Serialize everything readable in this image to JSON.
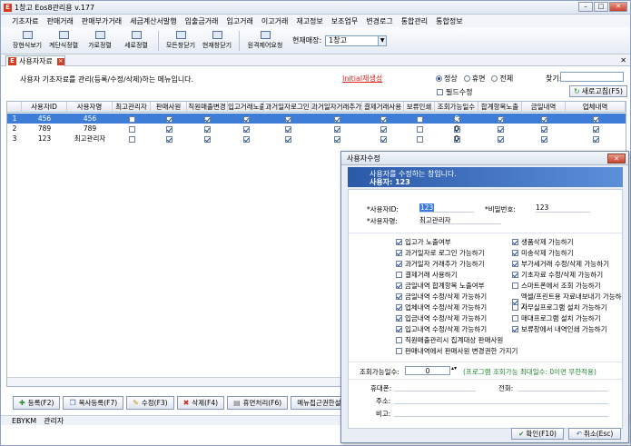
{
  "window": {
    "title": "1창고 Eos8관리용 v.177"
  },
  "menu": [
    "기초자료",
    "판매거래",
    "판매부가거래",
    "세금계산서발행",
    "입출금거래",
    "입고거래",
    "이고거래",
    "재고정보",
    "보조업무",
    "변경로그",
    "통합관리",
    "통합정보"
  ],
  "toolbar": {
    "buttons": [
      "장현식보기",
      "계단식정렬",
      "가로정렬",
      "세로정렬",
      "모든창닫기",
      "현재창닫기",
      "원격제어요청"
    ],
    "store_label": "현재매장:",
    "store_value": "1창고"
  },
  "tab": {
    "label": "사용자자료"
  },
  "info": {
    "description": "사용자 기초자료를 관리(등록/수정/삭제)하는 메뉴입니다.",
    "link": "Initial재생성",
    "radio_normal": "정상",
    "radio_leave": "휴면",
    "radio_all": "전체",
    "find_label": "찾기:",
    "filter_label": "필드수정",
    "refresh_label": "새로고침(F5)"
  },
  "grid": {
    "columns": [
      "사용자ID",
      "사용자명",
      "최고관리자",
      "판매사원",
      "직원매출변경",
      "입고거래노출",
      "과거일자로그인",
      "과거일자거래추가",
      "결제거래사용",
      "보류인쇄",
      "조회가능일수",
      "합계항목노출",
      "금일내역",
      "업체내역"
    ],
    "rows": [
      {
        "no": "1",
        "id": "456",
        "name": "456",
        "admin": false,
        "checks": [
          true,
          true,
          true,
          true,
          true,
          true,
          false,
          true
        ],
        "days": "0",
        "tail": [
          true,
          true,
          true
        ]
      },
      {
        "no": "2",
        "id": "789",
        "name": "789",
        "admin": false,
        "checks": [
          true,
          true,
          true,
          true,
          true,
          true,
          false,
          true
        ],
        "days": "0",
        "tail": [
          true,
          true,
          true
        ]
      },
      {
        "no": "3",
        "id": "123",
        "name": "최고관리자",
        "admin": false,
        "checks": [
          true,
          true,
          true,
          true,
          true,
          true,
          false,
          true
        ],
        "days": "0",
        "tail": [
          true,
          true,
          true
        ]
      }
    ]
  },
  "bottom_buttons": [
    "등록(F2)",
    "복사등록(F7)",
    "수정(F3)",
    "삭제(F4)",
    "휴면처리(F6)",
    "메뉴접근권한설정"
  ],
  "status": {
    "left": "EBYKM",
    "right": "관리자"
  },
  "dialog": {
    "title": "사용자수정",
    "header_line1": "사용자를 수정하는 창입니다.",
    "header_line2": "사용자: 123",
    "user_id_label": "*사용자ID:",
    "user_id_value": "123",
    "password_label": "*비밀번호:",
    "password_value": "123",
    "user_name_label": "*사용자명:",
    "user_name_value": "최고관리자",
    "options_left": [
      {
        "label": "입고가 노출여부",
        "checked": true
      },
      {
        "label": "과거일자로 로그인 가능하기",
        "checked": true
      },
      {
        "label": "과거일자 거래추가 가능하기",
        "checked": true
      },
      {
        "label": "결제거래 사용하기",
        "checked": false
      },
      {
        "label": "금일내역 합계항목 노출여부",
        "checked": true
      },
      {
        "label": "금일내역 수정/삭제 가능하기",
        "checked": true
      },
      {
        "label": "업체내역 수정/삭제 가능하기",
        "checked": true
      },
      {
        "label": "입금내역 수정/삭제 가능하기",
        "checked": true
      },
      {
        "label": "입고내역 수정/삭제 가능하기",
        "checked": true
      },
      {
        "label": "직원매출관리시 집계대상 판매사원",
        "checked": false
      },
      {
        "label": "판매내역에서 판매사원 변경권한 가지기",
        "checked": false
      }
    ],
    "options_right": [
      {
        "label": "생품삭제 가능하기",
        "checked": true
      },
      {
        "label": "미송삭제 가능하기",
        "checked": true
      },
      {
        "label": "부가세거래 수정/삭제 가능하기",
        "checked": true
      },
      {
        "label": "기초자료 수정/삭제 가능하기",
        "checked": true
      },
      {
        "label": "스마트폰에서 조회 가능하기",
        "checked": false
      },
      {
        "label": "엑셀/프린트용 자료내보내기 가능하기",
        "checked": true
      },
      {
        "label": "사무실프로그램 설치 가능하기",
        "checked": false
      },
      {
        "label": "매대프로그램 설치 가능하기",
        "checked": false
      },
      {
        "label": "보류창에서 내역인쇄 가능하기",
        "checked": true
      }
    ],
    "days_label": "조회가능일수:",
    "days_value": "0",
    "days_note": "(프로그램 조회가능 최대일수: 0이면 무한적용)",
    "phone_label": "휴대폰:",
    "tel_label": "전화:",
    "address_label": "주소:",
    "memo_label": "비고:",
    "ok_label": "확인(F10)",
    "cancel_label": "취소(Esc)"
  }
}
